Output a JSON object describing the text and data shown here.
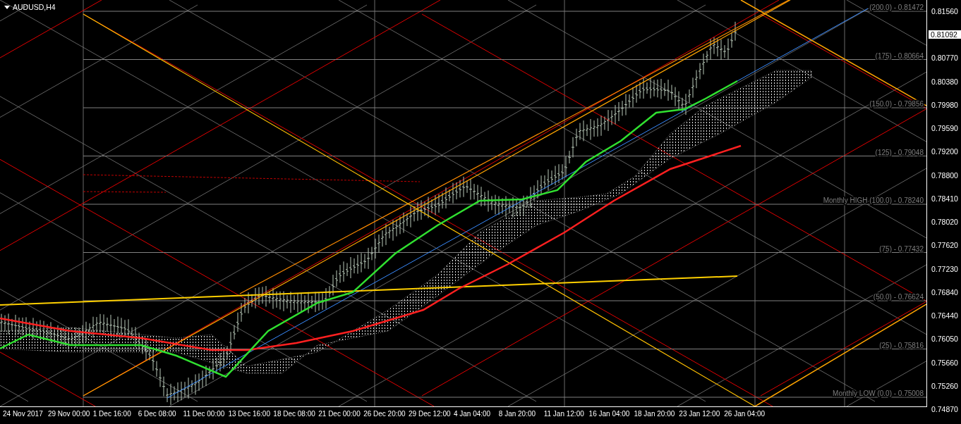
{
  "chart": {
    "symbol_label": "AUDUSD,H4",
    "current_price": "0.81092",
    "price_axis": [
      "0.81560",
      "0.80770",
      "0.80380",
      "0.79980",
      "0.79590",
      "0.79200",
      "0.78800",
      "0.78410",
      "0.78020",
      "0.77620",
      "0.77230",
      "0.76840",
      "0.76440",
      "0.76050",
      "0.75660",
      "0.75260",
      "0.74870"
    ],
    "time_axis": [
      "24 Nov 2017",
      "29 Nov 00:00",
      "1 Dec 16:00",
      "6 Dec 08:00",
      "11 Dec 00:00",
      "13 Dec 16:00",
      "18 Dec 08:00",
      "21 Dec 00:00",
      "26 Dec 20:00",
      "29 Dec 12:00",
      "4 Jan 04:00",
      "8 Jan 20:00",
      "11 Jan 12:00",
      "16 Jan 04:00",
      "18 Jan 20:00",
      "23 Jan 12:00",
      "26 Jan 04:00"
    ],
    "levels": [
      "(200.0) -  0.81472",
      "(175) -  0.80664",
      "(150.0) -  0.79856",
      "(125) -  0.79048",
      "Monthly HIGH (100.0) -  0.78240",
      "(75) -  0.77432",
      "(50.0) -  0.76624",
      "(25) -  0.75816",
      "Monthly LOW (0.0) -  0.75008"
    ]
  }
}
